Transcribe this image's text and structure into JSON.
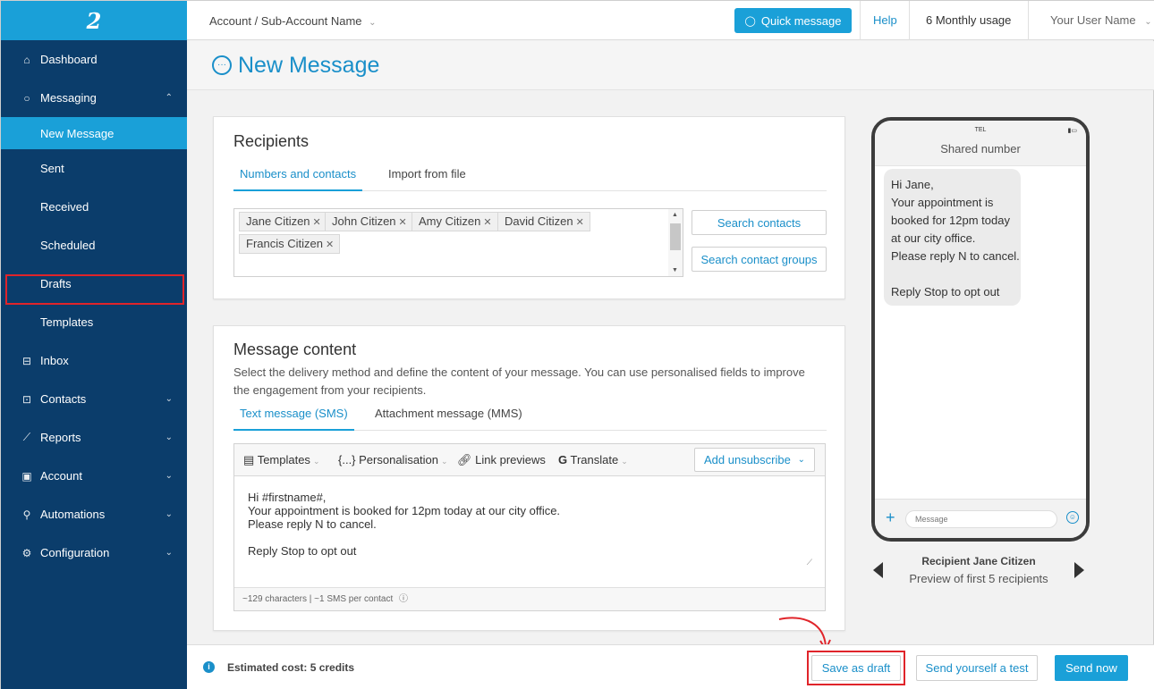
{
  "logo_text": "2",
  "sidebar": {
    "items": [
      {
        "label": "Dashboard",
        "icon": "home-icon",
        "chevron": ""
      },
      {
        "label": "Messaging",
        "icon": "circle-icon",
        "chevron": "^"
      },
      {
        "label": "New Message",
        "icon": "",
        "chevron": ""
      },
      {
        "label": "Sent",
        "icon": "",
        "chevron": ""
      },
      {
        "label": "Received",
        "icon": "",
        "chevron": ""
      },
      {
        "label": "Scheduled",
        "icon": "",
        "chevron": ""
      },
      {
        "label": "Drafts",
        "icon": "",
        "chevron": ""
      },
      {
        "label": "Templates",
        "icon": "",
        "chevron": ""
      },
      {
        "label": "Inbox",
        "icon": "inbox-icon",
        "chevron": ""
      },
      {
        "label": "Contacts",
        "icon": "contacts-icon",
        "chevron": "v"
      },
      {
        "label": "Reports",
        "icon": "reports-icon",
        "chevron": "v"
      },
      {
        "label": "Account",
        "icon": "account-icon",
        "chevron": "v"
      },
      {
        "label": "Automations",
        "icon": "automations-icon",
        "chevron": "v"
      },
      {
        "label": "Configuration",
        "icon": "gear-icon",
        "chevron": "v"
      }
    ]
  },
  "topbar": {
    "breadcrumb": "Account / Sub-Account Name",
    "quick_message": "Quick message",
    "help": "Help",
    "usage": "6 Monthly usage",
    "user": "Your User Name"
  },
  "page": {
    "title": "New Message"
  },
  "recipients": {
    "heading": "Recipients",
    "tabs": [
      "Numbers and contacts",
      "Import from file"
    ],
    "chips": [
      "Jane Citizen",
      "John Citizen",
      "Amy Citizen",
      "David Citizen",
      "Francis Citizen"
    ],
    "search_contacts": "Search contacts",
    "search_groups": "Search contact groups"
  },
  "content": {
    "heading": "Message content",
    "description": "Select the delivery method and define the content of your message. You can use personalised fields to improve the engagement from your recipients.",
    "tabs": [
      "Text message (SMS)",
      "Attachment message (MMS)"
    ],
    "toolbar": {
      "templates": "Templates",
      "personalisation": "{...} Personalisation",
      "link_previews": "Link previews",
      "translate": "Translate",
      "add_unsubscribe": "Add unsubscribe"
    },
    "message": "Hi #firstname#,\nYour appointment is booked for 12pm today at our city office.\nPlease reply N to cancel.\n\nReply Stop to opt out",
    "footer": "~129 characters | ~1 SMS per contact"
  },
  "phone": {
    "carrier": "TEL",
    "sender": "Shared number",
    "bubble": "Hi Jane,\nYour appointment is\nbooked for 12pm today\nat our city office.\nPlease reply N to cancel.\n\nReply Stop to opt out",
    "input_placeholder": "Message",
    "recipient": "Recipient Jane Citizen",
    "preview_note": "Preview of first 5 recipients"
  },
  "footer": {
    "estimate": "Estimated cost: 5 credits",
    "save_draft": "Save as draft",
    "send_test": "Send yourself a test",
    "send_now": "Send now"
  },
  "colors": {
    "sidebar": "#0b3d6b",
    "accent": "#1aa0d8",
    "link": "#1a8fc9",
    "highlight": "#e0242a"
  }
}
